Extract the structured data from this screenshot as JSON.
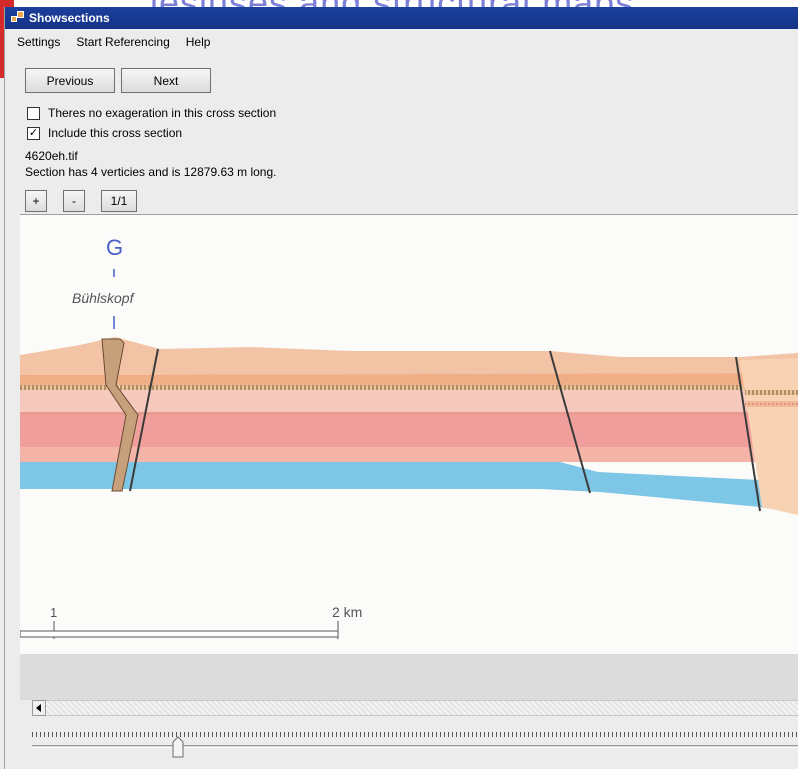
{
  "background_text": "lesluses and structural maps",
  "window": {
    "title": "Showsections"
  },
  "menu": {
    "items": [
      "Settings",
      "Start Referencing",
      "Help"
    ]
  },
  "nav": {
    "previous_label": "Previous",
    "next_label": "Next"
  },
  "options": {
    "no_exaggeration_label": "Theres no exageration in this cross section",
    "no_exaggeration_checked": false,
    "include_label": "Include this cross section",
    "include_checked": true
  },
  "file_info": {
    "filename": "4620eh.tif",
    "description": "Section has 4 verticies and is 12879.63 m long."
  },
  "zoom": {
    "zoom_in_label": "+",
    "zoom_out_label": "-",
    "reset_label": "1/1"
  },
  "section_image": {
    "marker_letter": "G",
    "place_name": "Bühlskopf",
    "scale_start_label": "1",
    "scale_end_label": "2 km"
  },
  "slider": {
    "position_fraction": 0.19
  },
  "colors": {
    "titlebar": "#1a3f9c",
    "marker_blue": "#4a5fc8",
    "layer_orange": "#f2b89a",
    "layer_pink": "#f1a3a2",
    "layer_blue": "#7ec6e6"
  }
}
